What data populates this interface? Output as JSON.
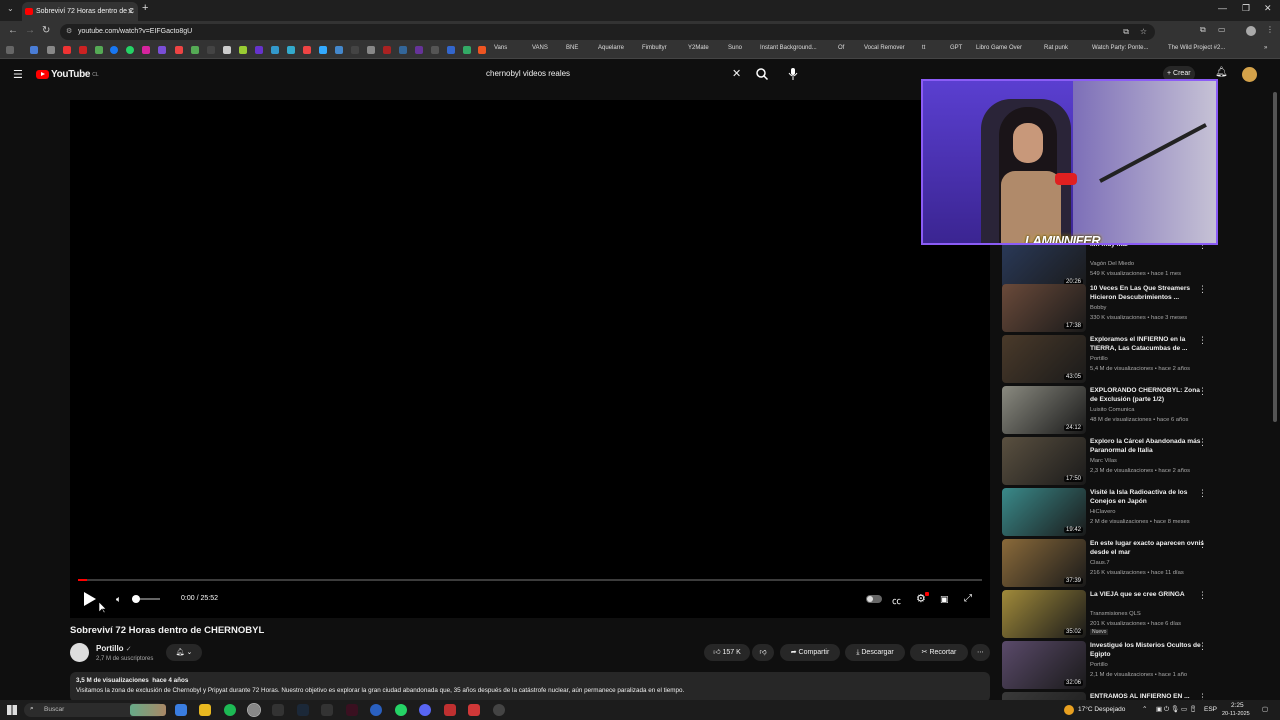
{
  "browser": {
    "tab_title": "Sobreviví 72 Horas dentro de C",
    "url": "youtube.com/watch?v=EIFGacto8gU",
    "bookmarks": [
      "Vans",
      "VANS",
      "BNE",
      "Aquelarre",
      "Fimbultyr",
      "Y2Mate",
      "Suno",
      "Instant Background...",
      "Of",
      "Vocal Remover",
      "tt",
      "GPT",
      "Libro Game Over",
      "Rat punk",
      "Watch Party: Ponte...",
      "The Wild Project #2..."
    ]
  },
  "youtube": {
    "logo_text": "YouTube",
    "region": "CL",
    "search_value": "chernobyl videos reales",
    "create_label": "Crear"
  },
  "player": {
    "time": "0:00 / 25:52",
    "progress": 0.01
  },
  "video": {
    "title": "Sobreviví 72 Horas dentro de CHERNOBYL",
    "channel": "Portillo",
    "subscribers": "2,7 M de suscriptores",
    "likes": "157 K",
    "share_label": "Compartir",
    "download_label": "Descargar",
    "clip_label": "Recortar",
    "stats": "3,5 M de visualizaciones  hace 4 años",
    "description": "Visitamos la zona de exclusión de Chernobyl y Pripyat durante 72 Horas. Nuestro objetivo es explorar la gran ciudad abandonada que, 35 años después de la catástrofe nuclear, aún permanece paralizada en el tiempo."
  },
  "webcam": {
    "overlay_name": "LAMINNIFER"
  },
  "recommendations": [
    {
      "title": "...n muy Mal",
      "channel": "Vagón Del Miedo",
      "meta": "549 K visualizaciones • hace 1 mes",
      "duration": "20:26",
      "color": "#2a3a5a"
    },
    {
      "title": "10 Veces En Las Que Streamers Hicieron Descubrimientos ...",
      "channel": "Bobby",
      "meta": "330 K visualizaciones • hace 3 meses",
      "duration": "17:38",
      "color": "#6a4a3a"
    },
    {
      "title": "Exploramos el INFIERNO en la TIERRA, Las Catacumbas de ...",
      "channel": "Portillo",
      "meta": "5,4 M de visualizaciones • hace 2 años",
      "duration": "43:05",
      "color": "#4a3a2a"
    },
    {
      "title": "EXPLORANDO CHERNOBYL: Zona de Exclusión (parte 1/2)",
      "channel": "Luisito Comunica",
      "meta": "48 M de visualizaciones • hace 6 años",
      "duration": "24:12",
      "color": "#8a8a80"
    },
    {
      "title": "Exploro la Cárcel Abandonada más Paranormal de Italia",
      "channel": "Marc Vilas",
      "meta": "2,3 M de visualizaciones • hace 2 años",
      "duration": "17:50",
      "color": "#5a5040"
    },
    {
      "title": "Visité la Isla Radioactiva de los Conejos en Japón",
      "channel": "HiClavero",
      "meta": "2 M de visualizaciones • hace 8 meses",
      "duration": "19:42",
      "color": "#3a8a8a"
    },
    {
      "title": "En este lugar exacto aparecen ovnis desde el mar",
      "channel": "Claus.7",
      "meta": "216 K visualizaciones • hace 11 días",
      "duration": "37:39",
      "color": "#8a6a3a"
    },
    {
      "title": "La VIEJA que se cree GRINGA",
      "channel": "Transmisiones QLS",
      "meta": "201 K visualizaciones • hace 6 días",
      "duration": "35:02",
      "color": "#a08a3a",
      "badge": "Nuevo"
    },
    {
      "title": "Investigué los Misterios Ocultos de Egipto",
      "channel": "Portillo",
      "meta": "2,1 M de visualizaciones • hace 1 año",
      "duration": "32:06",
      "color": "#5a4a6a"
    },
    {
      "title": "ENTRAMOS AL INFIERNO EN ...",
      "channel": "",
      "meta": "",
      "duration": "",
      "color": "#3a3a3a"
    }
  ],
  "taskbar": {
    "search_placeholder": "Buscar",
    "weather": "17°C  Despejado",
    "language": "ESP",
    "time": "2:25",
    "date": "20-11-2025"
  }
}
